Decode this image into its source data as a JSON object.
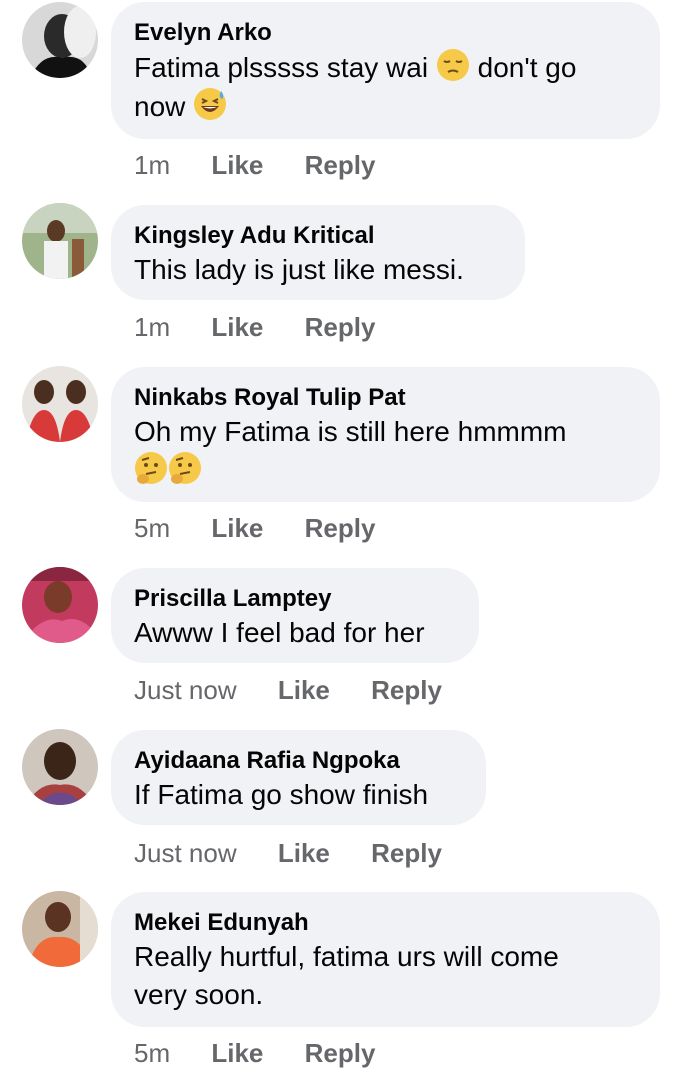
{
  "comments": [
    {
      "name": "Evelyn Arko",
      "text_before": "Fatima plsssss stay wai",
      "text_middle": "don't go",
      "text_after": "now",
      "time": "1m",
      "like": "Like",
      "reply": "Reply"
    },
    {
      "name": "Kingsley Adu Kritical",
      "text": "This lady is just like messi.",
      "time": "1m",
      "like": "Like",
      "reply": "Reply"
    },
    {
      "name": "Ninkabs Royal Tulip Pat",
      "text": "Oh my Fatima is still here hmmmm",
      "time": "5m",
      "like": "Like",
      "reply": "Reply"
    },
    {
      "name": "Priscilla Lamptey",
      "text": "Awww I feel bad for her",
      "time": "Just now",
      "like": "Like",
      "reply": "Reply"
    },
    {
      "name": "Ayidaana Rafia Ngpoka",
      "text": "If Fatima go show finish",
      "time": "Just now",
      "like": "Like",
      "reply": "Reply"
    },
    {
      "name": "Mekei Edunyah",
      "text_line1": "Really hurtful, fatima urs will come",
      "text_line2": "very soon.",
      "time": "5m",
      "like": "Like",
      "reply": "Reply"
    }
  ]
}
